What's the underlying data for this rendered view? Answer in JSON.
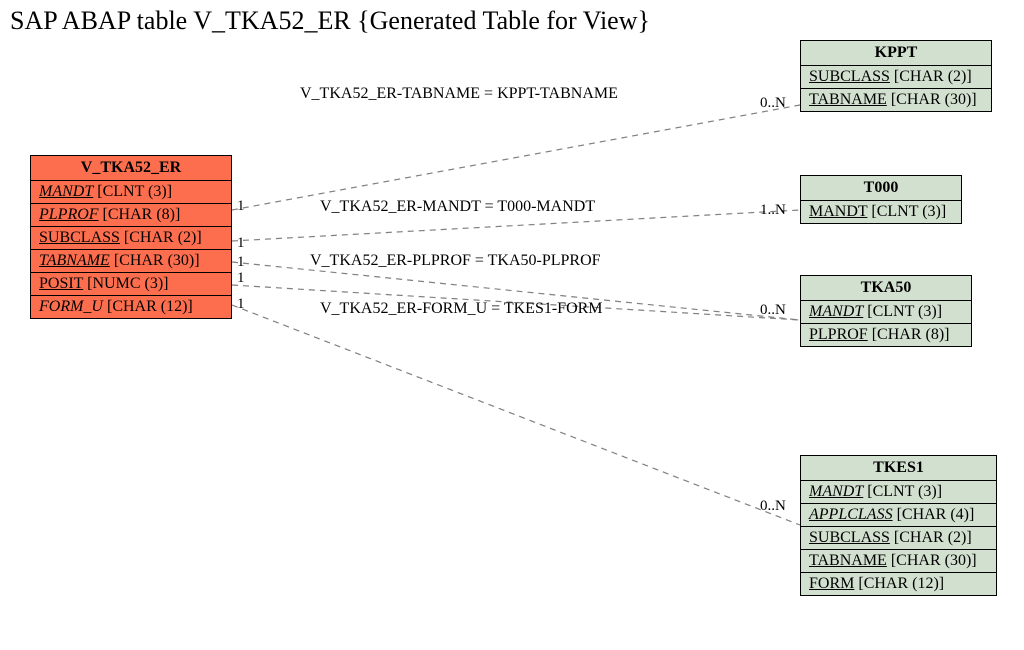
{
  "title": "SAP ABAP table V_TKA52_ER {Generated Table for View}",
  "main": {
    "name": "V_TKA52_ER",
    "fields": [
      {
        "label": "MANDT",
        "type": "[CLNT (3)]",
        "key": true,
        "fk": true
      },
      {
        "label": "PLPROF",
        "type": "[CHAR (8)]",
        "key": true,
        "fk": true
      },
      {
        "label": "SUBCLASS",
        "type": "[CHAR (2)]",
        "key": true,
        "fk": false
      },
      {
        "label": "TABNAME",
        "type": "[CHAR (30)]",
        "key": true,
        "fk": true
      },
      {
        "label": "POSIT",
        "type": "[NUMC (3)]",
        "key": true,
        "fk": false
      },
      {
        "label": "FORM_U",
        "type": "[CHAR (12)]",
        "key": false,
        "fk": true
      }
    ]
  },
  "targets": {
    "kppt": {
      "name": "KPPT",
      "fields": [
        {
          "label": "SUBCLASS",
          "type": "[CHAR (2)]",
          "key": true,
          "fk": false
        },
        {
          "label": "TABNAME",
          "type": "[CHAR (30)]",
          "key": true,
          "fk": false
        }
      ]
    },
    "t000": {
      "name": "T000",
      "fields": [
        {
          "label": "MANDT",
          "type": "[CLNT (3)]",
          "key": true,
          "fk": false
        }
      ]
    },
    "tka50": {
      "name": "TKA50",
      "fields": [
        {
          "label": "MANDT",
          "type": "[CLNT (3)]",
          "key": true,
          "fk": true
        },
        {
          "label": "PLPROF",
          "type": "[CHAR (8)]",
          "key": true,
          "fk": false
        }
      ]
    },
    "tkes1": {
      "name": "TKES1",
      "fields": [
        {
          "label": "MANDT",
          "type": "[CLNT (3)]",
          "key": true,
          "fk": true
        },
        {
          "label": "APPLCLASS",
          "type": "[CHAR (4)]",
          "key": true,
          "fk": true
        },
        {
          "label": "SUBCLASS",
          "type": "[CHAR (2)]",
          "key": true,
          "fk": false
        },
        {
          "label": "TABNAME",
          "type": "[CHAR (30)]",
          "key": true,
          "fk": false
        },
        {
          "label": "FORM",
          "type": "[CHAR (12)]",
          "key": true,
          "fk": false
        }
      ]
    }
  },
  "relations": {
    "r1": {
      "label": "V_TKA52_ER-TABNAME = KPPT-TABNAME",
      "leftCard": "1",
      "rightCard": "0..N"
    },
    "r2": {
      "label": "V_TKA52_ER-MANDT = T000-MANDT",
      "leftCard": "1",
      "rightCard": "1..N"
    },
    "r3": {
      "label": "V_TKA52_ER-PLPROF = TKA50-PLPROF",
      "leftCard": "1",
      "rightCard": ""
    },
    "r4": {
      "label": "V_TKA52_ER-FORM_U = TKES1-FORM",
      "leftCard": "1",
      "rightCard": "0..N"
    },
    "r5cardLeft": "",
    "r5cardRight": "0..N"
  },
  "chart_data": {
    "type": "er-diagram",
    "main_entity": "V_TKA52_ER",
    "relations": [
      {
        "from": "V_TKA52_ER",
        "to": "KPPT",
        "join": "V_TKA52_ER-TABNAME = KPPT-TABNAME",
        "left_card": "1",
        "right_card": "0..N"
      },
      {
        "from": "V_TKA52_ER",
        "to": "T000",
        "join": "V_TKA52_ER-MANDT = T000-MANDT",
        "left_card": "1",
        "right_card": "1..N"
      },
      {
        "from": "V_TKA52_ER",
        "to": "TKA50",
        "join": "V_TKA52_ER-PLPROF = TKA50-PLPROF",
        "left_card": "1",
        "right_card": ""
      },
      {
        "from": "V_TKA52_ER",
        "to": "TKES1",
        "join": "V_TKA52_ER-FORM_U = TKES1-FORM",
        "left_card": "1",
        "right_card": "0..N"
      },
      {
        "from": "V_TKA52_ER",
        "to": "TKES1",
        "join": "",
        "left_card": "",
        "right_card": "0..N"
      }
    ]
  }
}
